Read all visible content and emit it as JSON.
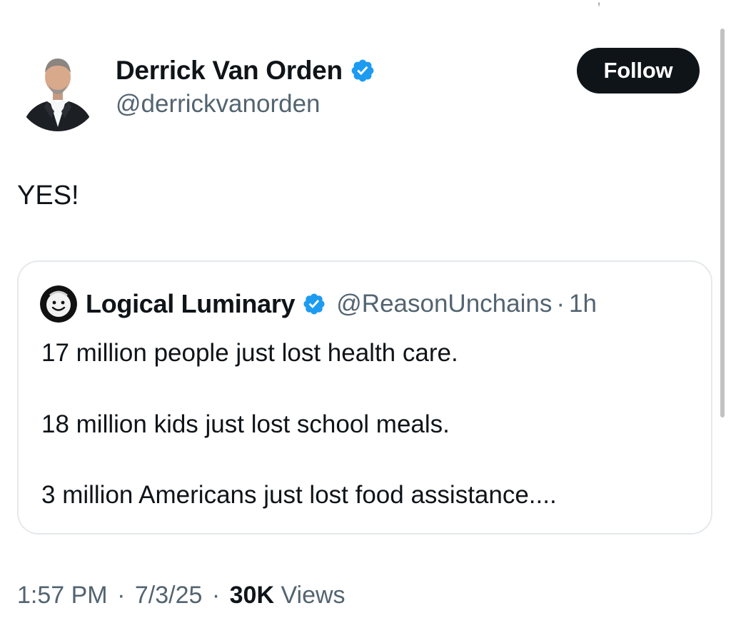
{
  "tweet": {
    "author": {
      "display_name": "Derrick Van Orden",
      "handle": "@derrickvanorden",
      "verified_icon": "verified-badge-icon",
      "avatar_icon": "profile-photo"
    },
    "follow_label": "Follow",
    "text": "YES!",
    "quoted": {
      "display_name": "Logical Luminary",
      "handle": "@ReasonUnchains",
      "separator": "·",
      "time": "1h",
      "lines": [
        "17 million people just lost health care.",
        "18 million kids just lost school meals.",
        "3 million Americans just lost food assistance...."
      ]
    },
    "meta": {
      "time": "1:57 PM",
      "date": "7/3/25",
      "separator": "·",
      "views_count": "30K",
      "views_label": "Views"
    }
  },
  "colors": {
    "verified_blue": "#1d9bf0",
    "text_primary": "#0f1419",
    "text_secondary": "#536471",
    "button_bg": "#0f1419",
    "card_border": "#e6e9ec"
  }
}
